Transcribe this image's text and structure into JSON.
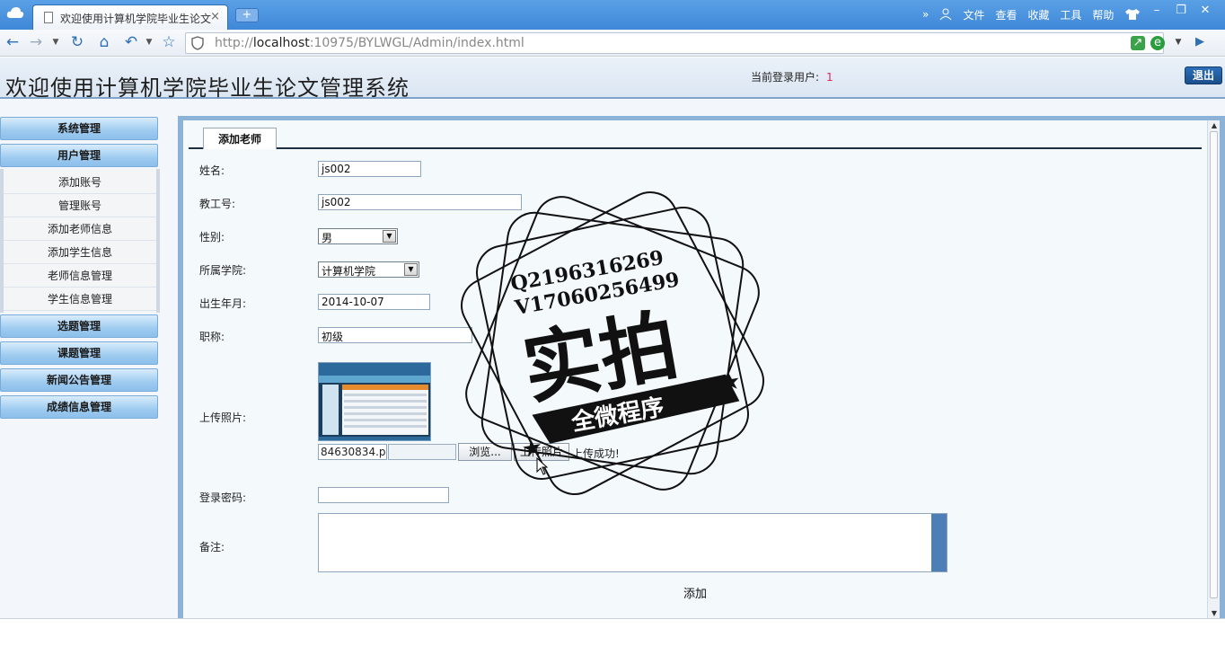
{
  "browser": {
    "tab_title": "欢迎使用计算机学院毕业生论文",
    "tab_close": "×",
    "new_tab": "+",
    "menu": [
      "文件",
      "查看",
      "收藏",
      "工具",
      "帮助"
    ],
    "more": "»",
    "url_prefix": "http://",
    "url_host": "localhost",
    "url_rest": ":10975/BYLWGL/Admin/index.html"
  },
  "header": {
    "title": "欢迎使用计算机学院毕业生论文管理系统",
    "login_label": "当前登录用户:",
    "login_user": "1",
    "logout": "退出"
  },
  "sidebar": {
    "system": "系统管理",
    "user": "用户管理",
    "user_items": [
      "添加账号",
      "管理账号",
      "添加老师信息",
      "添加学生信息",
      "老师信息管理",
      "学生信息管理"
    ],
    "topic_select": "选题管理",
    "topic": "课题管理",
    "news": "新闻公告管理",
    "score": "成绩信息管理"
  },
  "form": {
    "tab": "添加老师",
    "name_label": "姓名:",
    "name_value": "js002",
    "id_label": "教工号:",
    "id_value": "js002",
    "gender_label": "性别:",
    "gender_value": "男",
    "college_label": "所属学院:",
    "college_value": "计算机学院",
    "birth_label": "出生年月:",
    "birth_value": "2014-10-07",
    "title_label": "职称:",
    "title_value": "初级",
    "photo_label": "上传照片:",
    "photo_filename": "84630834.p",
    "browse": "浏览...",
    "upload": "上传照片",
    "upload_ok": "上传成功!",
    "password_label": "登录密码:",
    "password_value": "",
    "remark_label": "备注:",
    "add": "添加"
  },
  "watermark": {
    "line1": "Q2196316269",
    "line2": "V17060256499",
    "big": "实拍",
    "banner": "全微程序"
  },
  "colors": {
    "accent": "#3f88d8",
    "menu": "#9ecbf0",
    "logout": "#1b4f8c",
    "login_user": "#e0245e"
  }
}
